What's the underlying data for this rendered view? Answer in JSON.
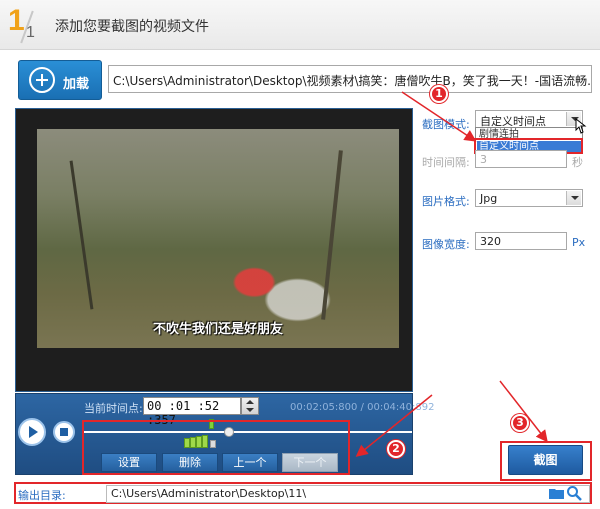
{
  "header": {
    "step": "1",
    "total": "1",
    "title": "添加您要截图的视频文件"
  },
  "toolbar": {
    "add_label": "加载",
    "file_path": "C:\\Users\\Administrator\\Desktop\\视频素材\\搞笑：唐僧吹牛B，笑了我一天！-国语流畅.c"
  },
  "video": {
    "subtitle": "不吹牛我们还是好朋友"
  },
  "settings": {
    "mode_label": "截图模式:",
    "mode_value": "自定义时间点",
    "mode_options": [
      "剧情连拍",
      "自定义时间点"
    ],
    "interval_label": "时间间隔:",
    "interval_value": "3",
    "interval_unit": "秒",
    "format_label": "图片格式:",
    "format_value": "Jpg",
    "width_label": "图像宽度:",
    "width_value": "320",
    "width_unit": "Px"
  },
  "controls": {
    "time_label": "当前时间点:",
    "time_value": "00 :01 :52 :357",
    "duration": "00:02:05:800 / 00:04:40:892",
    "buttons": [
      "设置",
      "删除",
      "上一个",
      "下一个"
    ]
  },
  "capture_label": "截图",
  "output": {
    "label": "输出目录:",
    "path": "C:\\Users\\Administrator\\Desktop\\11\\"
  },
  "annotations": [
    "1",
    "2",
    "3"
  ],
  "colors": {
    "accent_red": "#e2262a",
    "brand_blue": "#1f5fa3",
    "step_orange": "#f0a21a"
  }
}
